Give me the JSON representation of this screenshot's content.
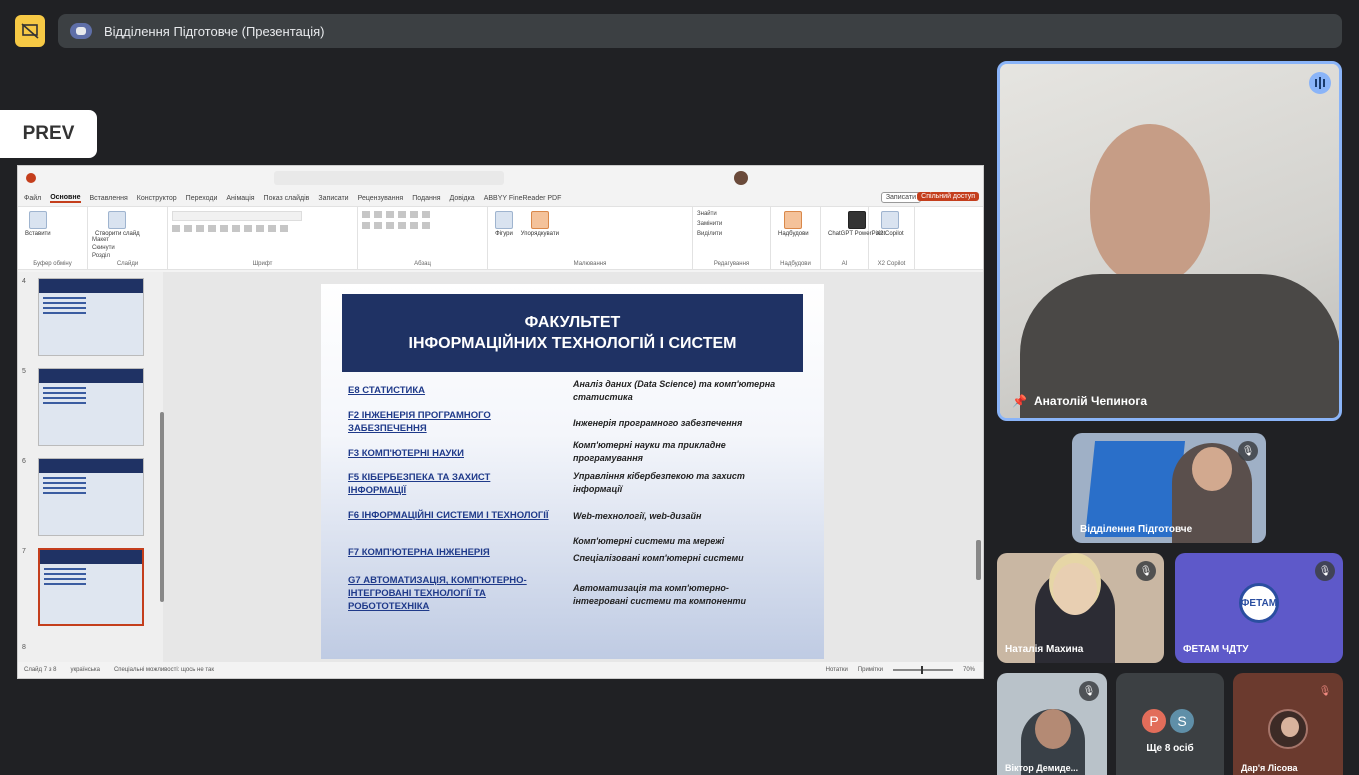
{
  "meeting": {
    "title": "Відділення Підготовче (Презентація)",
    "prev_label": "PREV"
  },
  "ppt": {
    "menu": [
      "Файл",
      "Основне",
      "Вставлення",
      "Конструктор",
      "Переходи",
      "Анімація",
      "Показ слайдів",
      "Записати",
      "Рецензування",
      "Подання",
      "Довідка",
      "ABBYY FineReader PDF"
    ],
    "active_tab": "Основне",
    "record_label": "Записати",
    "share_label": "Спільний доступ",
    "ribbon": {
      "paste": "Вставити",
      "new_slide": "Створити слайд",
      "layout": "Макет",
      "reset": "Скинути",
      "section": "Розділ",
      "shapes": "Фігури",
      "arrange": "Упорядкувати",
      "find": "Знайти",
      "replace": "Замінити",
      "select": "Виділити",
      "addins": "Надбудови",
      "chatgpt": "ChatGPT PowerPoint",
      "copilot": "X2 Copilot",
      "groups": {
        "clipboard": "Буфер обміну",
        "slides": "Слайди",
        "font": "Шрифт",
        "paragraph": "Абзац",
        "drawing": "Малювання",
        "editing": "Редагування",
        "addins": "Надбудови",
        "ai": "AI",
        "copilot": "X2 Copilot"
      }
    },
    "thumb_numbers": [
      "4",
      "5",
      "6",
      "7",
      "8"
    ],
    "status": {
      "slide": "Слайд 7 з 8",
      "language": "українська",
      "accessibility": "Спеціальні можливості: щось не так",
      "notes": "Нотатки",
      "comments": "Примітки",
      "zoom": "70%"
    },
    "slide": {
      "title_line1": "ФАКУЛЬТЕТ",
      "title_line2": "ІНФОРМАЦІЙНИХ ТЕХНОЛОГІЙ І СИСТЕМ",
      "left": [
        "Е8 СТАТИСТИКА",
        "F2 ІНЖЕНЕРІЯ ПРОГРАМНОГО ЗАБЕЗПЕЧЕННЯ",
        "F3 КОМП'ЮТЕРНІ НАУКИ",
        "F5 КІБЕРБЕЗПЕКА ТА ЗАХИСТ ІНФОРМАЦІЇ",
        "F6 ІНФОРМАЦІЙНІ СИСТЕМИ І ТЕХНОЛОГІЇ",
        "F7 КОМП'ЮТЕРНА ІНЖЕНЕРІЯ",
        "G7 АВТОМАТИЗАЦІЯ, КОМП'ЮТЕРНО-ІНТЕГРОВАНІ ТЕХНОЛОГІЇ ТА РОБОТОТЕХНІКА"
      ],
      "right": [
        "Аналіз даних (Data Science) та комп'ютерна статистика",
        "Інженерія програмного забезпечення",
        "Комп'ютерні науки та прикладне програмування",
        "Управління кібербезпекою та захист інформації",
        "Web-технології, web-дизайн",
        "Комп'ютерні системи та мережі",
        "Спеціалізовані комп'ютерні системи",
        "Автоматизація та комп'ютерно-інтегровані системи та компоненти"
      ]
    }
  },
  "participants": {
    "speaker": "Анатолій Чепинога",
    "t2": "Відділення Підготовче",
    "t3": "Наталія Махина",
    "t4": "ФЕТАМ ЧДТУ",
    "t4_logo": "ФЕТАМ",
    "t5": "Віктор Демиде...",
    "t6_av1": "P",
    "t6_av2": "S",
    "t6_more": "Ще 8 осіб",
    "t7": "Дар'я Лісова"
  },
  "colors": {
    "slide_header": "#1f3264",
    "speaker_border": "#8ab4f8",
    "accent_yellow": "#f6c945",
    "ppt_accent": "#c43e1c"
  }
}
